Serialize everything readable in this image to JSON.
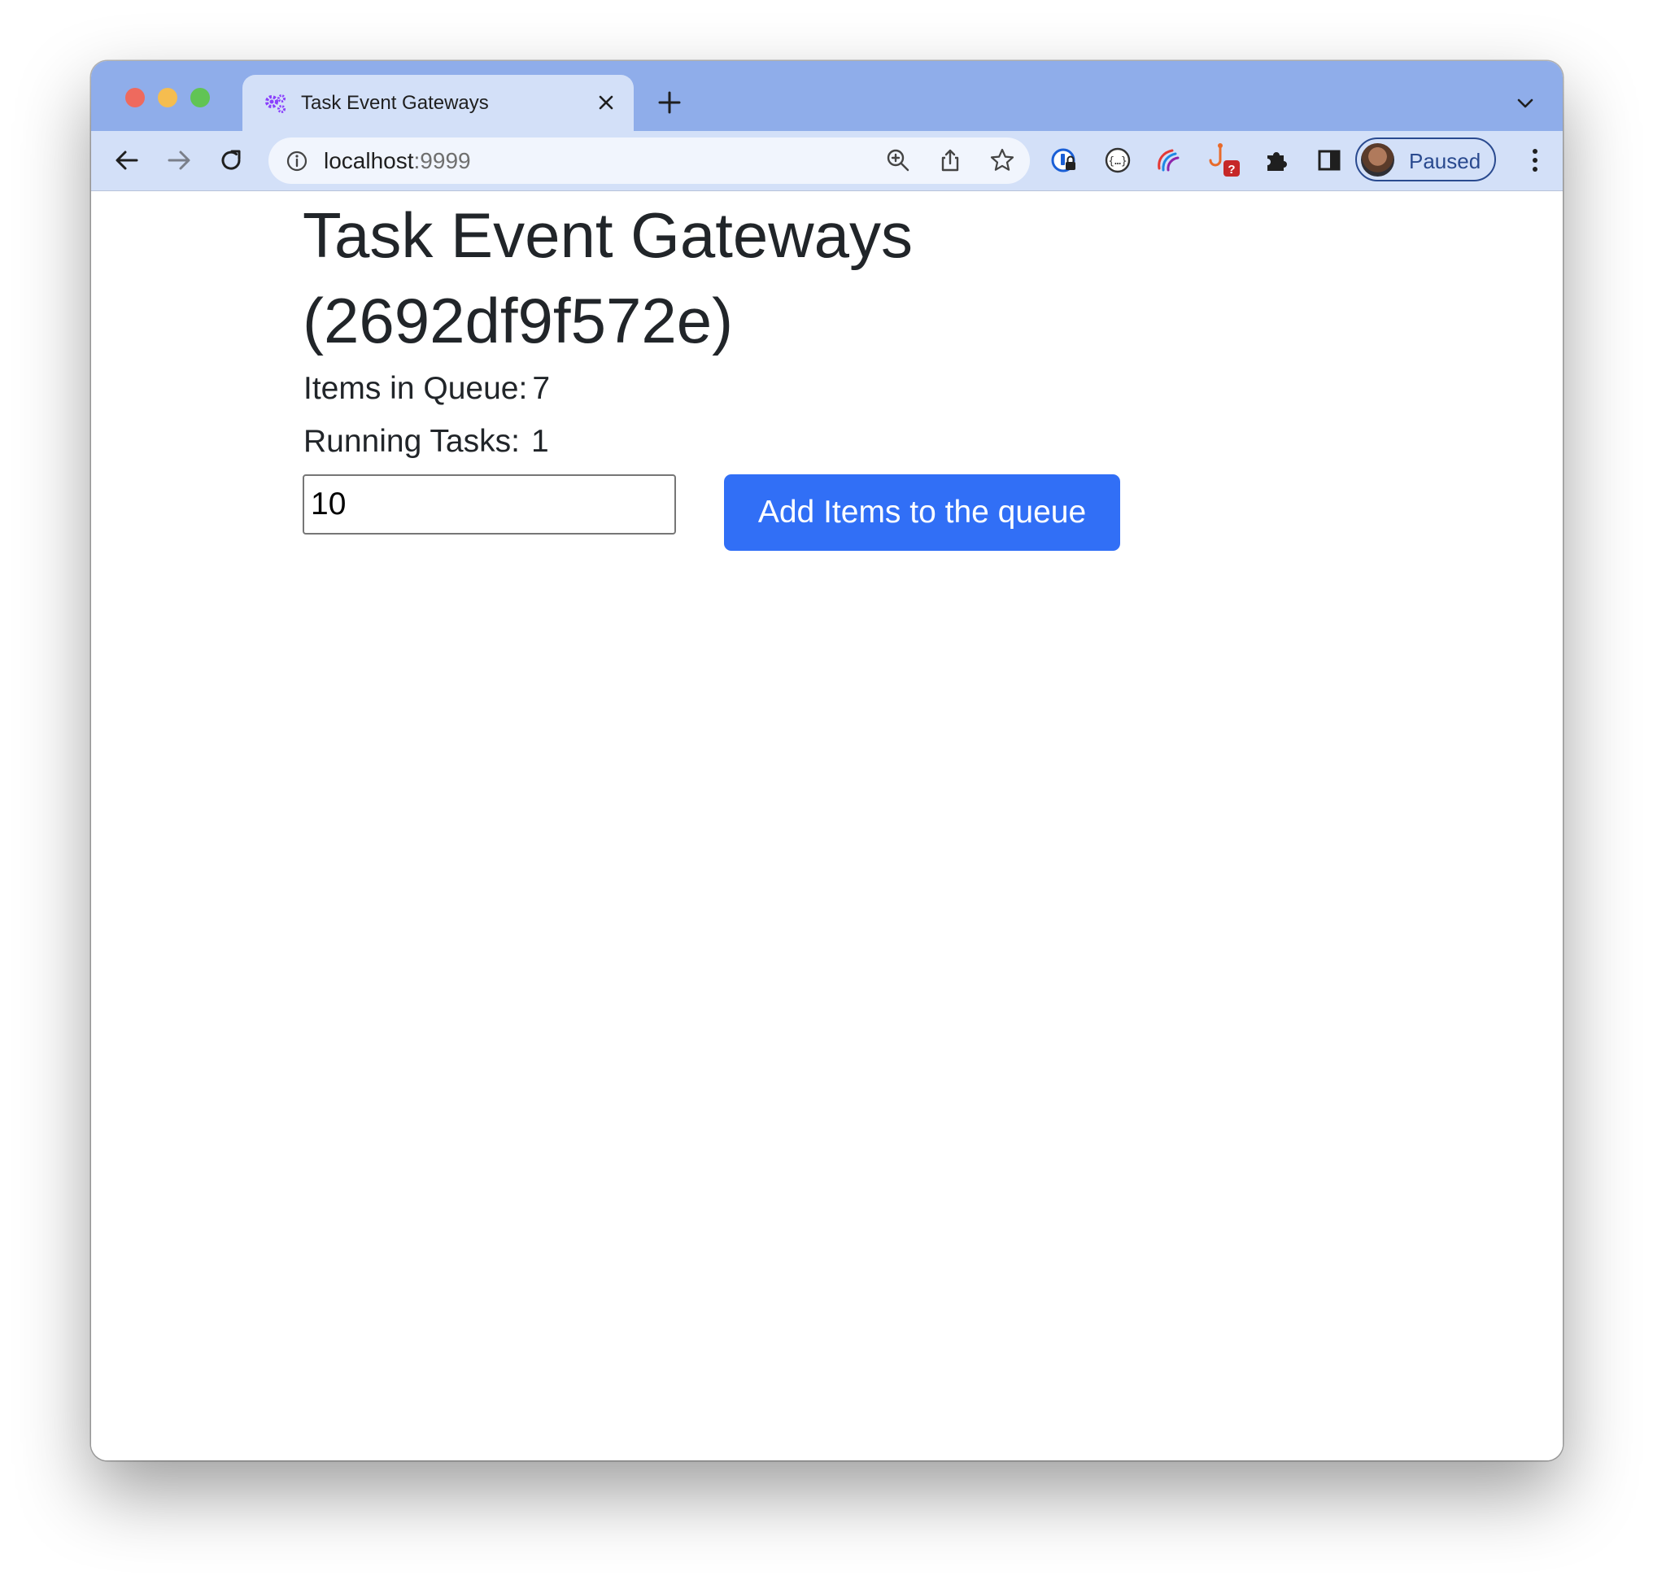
{
  "browser": {
    "tab": {
      "title": "Task Event Gateways",
      "favicon": "gears-icon"
    },
    "omnibox": {
      "host": "localhost",
      "port": ":9999"
    },
    "profile": {
      "label": "Paused"
    },
    "colors": {
      "tabstrip": "#8fadea",
      "toolbar": "#d3e0f8",
      "accent": "#2a4a8f"
    }
  },
  "page": {
    "title": "Task Event Gateways (2692df9f572e)",
    "queue_label": "Items in Queue:",
    "queue_value": "7",
    "running_label": "Running Tasks:",
    "running_value": "1",
    "input_value": "10",
    "add_button_label": "Add Items to the queue",
    "colors": {
      "text": "#212529",
      "button": "#316ff6"
    }
  }
}
